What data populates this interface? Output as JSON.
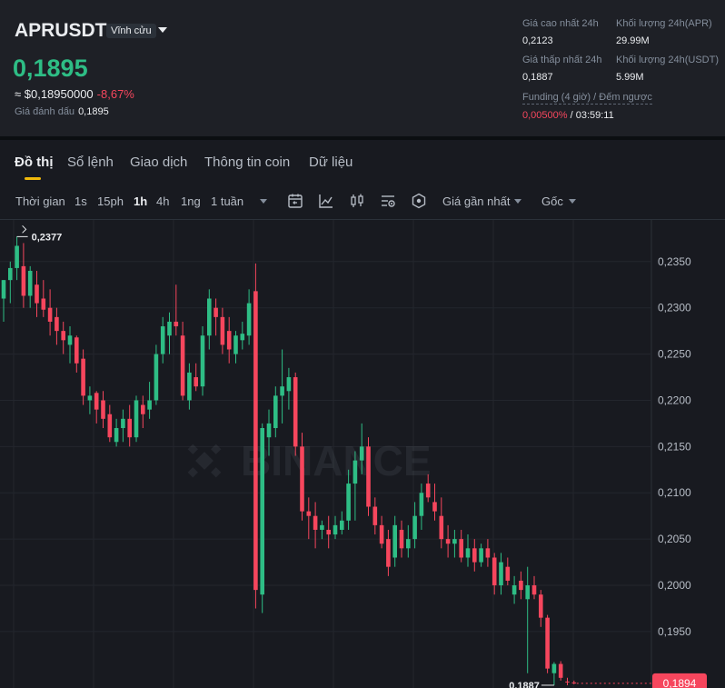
{
  "header": {
    "symbol": "APRUSDT",
    "contract_type": "Vĩnh cửu",
    "last_price": "0,1895",
    "approx_usd": "≈ $0,18950000",
    "change_pct": "-8,67%",
    "mark_label": "Giá đánh dấu",
    "mark_price": "0,1895",
    "stats": {
      "high_label": "Giá cao nhất 24h",
      "high_value": "0,2123",
      "vol_base_label": "Khối lượng 24h(APR)",
      "vol_base_value": "29.99M",
      "low_label": "Giá thấp nhất 24h",
      "low_value": "0,1887",
      "vol_quote_label": "Khối lượng 24h(USDT)",
      "vol_quote_value": "5.99M",
      "funding_label": "Funding (4 giờ) / Đếm ngược",
      "funding_rate": "0,00500%",
      "funding_sep": " / ",
      "countdown": "03:59:11"
    }
  },
  "tabs": [
    "Đồ thị",
    "Sổ lệnh",
    "Giao dịch",
    "Thông tin coin",
    "Dữ liệu"
  ],
  "toolbar": {
    "time_label": "Thời gian",
    "intervals": [
      "1s",
      "15ph",
      "1h",
      "4h",
      "1ng",
      "1 tuần"
    ],
    "active_interval": "1h",
    "price_source": "Giá gần nhất",
    "scale": "Gốc",
    "icons": [
      "calendar-icon",
      "indicator-icon",
      "candle-type-icon",
      "chart-settings-icon",
      "depth-icon"
    ]
  },
  "chart_data": {
    "type": "candlestick",
    "interval": "1h",
    "watermark": "BINANCE",
    "y_ticks": [
      "0,2350",
      "0,2300",
      "0,2250",
      "0,2200",
      "0,2150",
      "0,2100",
      "0,2050",
      "0,2000",
      "0,1950"
    ],
    "ylim": [
      0.1889,
      0.2395
    ],
    "high_marker": "0,2377",
    "low_marker": "0,1887",
    "current_price_label": "0,1894",
    "colors": {
      "up": "#2ebd85",
      "down": "#f6465d",
      "grid": "#23262d",
      "axis_text": "#b7bdc6"
    },
    "candles": [
      {
        "o": 0.231,
        "h": 0.233,
        "l": 0.2285,
        "c": 0.233
      },
      {
        "o": 0.233,
        "h": 0.235,
        "l": 0.2305,
        "c": 0.2343
      },
      {
        "o": 0.2343,
        "h": 0.2377,
        "l": 0.233,
        "c": 0.2367
      },
      {
        "o": 0.2345,
        "h": 0.237,
        "l": 0.23,
        "c": 0.2313
      },
      {
        "o": 0.2313,
        "h": 0.2345,
        "l": 0.23,
        "c": 0.234
      },
      {
        "o": 0.2325,
        "h": 0.234,
        "l": 0.229,
        "c": 0.2305
      },
      {
        "o": 0.231,
        "h": 0.233,
        "l": 0.229,
        "c": 0.2298
      },
      {
        "o": 0.23,
        "h": 0.232,
        "l": 0.227,
        "c": 0.2285
      },
      {
        "o": 0.229,
        "h": 0.23,
        "l": 0.226,
        "c": 0.2275
      },
      {
        "o": 0.2275,
        "h": 0.2285,
        "l": 0.225,
        "c": 0.2265
      },
      {
        "o": 0.226,
        "h": 0.228,
        "l": 0.224,
        "c": 0.227
      },
      {
        "o": 0.2268,
        "h": 0.227,
        "l": 0.223,
        "c": 0.224
      },
      {
        "o": 0.2245,
        "h": 0.2255,
        "l": 0.2195,
        "c": 0.2205
      },
      {
        "o": 0.22,
        "h": 0.2215,
        "l": 0.2185,
        "c": 0.2205
      },
      {
        "o": 0.2208,
        "h": 0.221,
        "l": 0.2175,
        "c": 0.219
      },
      {
        "o": 0.22,
        "h": 0.221,
        "l": 0.217,
        "c": 0.218
      },
      {
        "o": 0.2185,
        "h": 0.2195,
        "l": 0.2155,
        "c": 0.216
      },
      {
        "o": 0.2155,
        "h": 0.218,
        "l": 0.215,
        "c": 0.217
      },
      {
        "o": 0.217,
        "h": 0.219,
        "l": 0.2155,
        "c": 0.218
      },
      {
        "o": 0.218,
        "h": 0.2195,
        "l": 0.215,
        "c": 0.216
      },
      {
        "o": 0.216,
        "h": 0.2205,
        "l": 0.2155,
        "c": 0.22
      },
      {
        "o": 0.2195,
        "h": 0.2205,
        "l": 0.217,
        "c": 0.2185
      },
      {
        "o": 0.219,
        "h": 0.222,
        "l": 0.218,
        "c": 0.22
      },
      {
        "o": 0.22,
        "h": 0.226,
        "l": 0.2195,
        "c": 0.225
      },
      {
        "o": 0.225,
        "h": 0.229,
        "l": 0.224,
        "c": 0.228
      },
      {
        "o": 0.227,
        "h": 0.2295,
        "l": 0.225,
        "c": 0.2285
      },
      {
        "o": 0.2285,
        "h": 0.2325,
        "l": 0.227,
        "c": 0.228
      },
      {
        "o": 0.227,
        "h": 0.2285,
        "l": 0.22,
        "c": 0.2205
      },
      {
        "o": 0.22,
        "h": 0.224,
        "l": 0.219,
        "c": 0.223
      },
      {
        "o": 0.2225,
        "h": 0.224,
        "l": 0.221,
        "c": 0.2215
      },
      {
        "o": 0.2215,
        "h": 0.228,
        "l": 0.2205,
        "c": 0.227
      },
      {
        "o": 0.227,
        "h": 0.232,
        "l": 0.2255,
        "c": 0.231
      },
      {
        "o": 0.23,
        "h": 0.231,
        "l": 0.227,
        "c": 0.229
      },
      {
        "o": 0.229,
        "h": 0.23,
        "l": 0.225,
        "c": 0.226
      },
      {
        "o": 0.2275,
        "h": 0.229,
        "l": 0.224,
        "c": 0.2255
      },
      {
        "o": 0.225,
        "h": 0.2275,
        "l": 0.224,
        "c": 0.227
      },
      {
        "o": 0.2265,
        "h": 0.2285,
        "l": 0.2255,
        "c": 0.2272
      },
      {
        "o": 0.227,
        "h": 0.232,
        "l": 0.226,
        "c": 0.2305
      },
      {
        "o": 0.2318,
        "h": 0.2348,
        "l": 0.1975,
        "c": 0.1995
      },
      {
        "o": 0.199,
        "h": 0.2175,
        "l": 0.197,
        "c": 0.217
      },
      {
        "o": 0.216,
        "h": 0.219,
        "l": 0.214,
        "c": 0.2175
      },
      {
        "o": 0.217,
        "h": 0.2215,
        "l": 0.216,
        "c": 0.2205
      },
      {
        "o": 0.2205,
        "h": 0.2255,
        "l": 0.2175,
        "c": 0.2215
      },
      {
        "o": 0.221,
        "h": 0.2235,
        "l": 0.219,
        "c": 0.2225
      },
      {
        "o": 0.2225,
        "h": 0.223,
        "l": 0.214,
        "c": 0.215
      },
      {
        "o": 0.215,
        "h": 0.2165,
        "l": 0.207,
        "c": 0.208
      },
      {
        "o": 0.208,
        "h": 0.2095,
        "l": 0.205,
        "c": 0.2075
      },
      {
        "o": 0.2075,
        "h": 0.209,
        "l": 0.204,
        "c": 0.206
      },
      {
        "o": 0.206,
        "h": 0.207,
        "l": 0.205,
        "c": 0.2065
      },
      {
        "o": 0.206,
        "h": 0.2075,
        "l": 0.204,
        "c": 0.2055
      },
      {
        "o": 0.2055,
        "h": 0.2075,
        "l": 0.205,
        "c": 0.2065
      },
      {
        "o": 0.206,
        "h": 0.208,
        "l": 0.2055,
        "c": 0.207
      },
      {
        "o": 0.207,
        "h": 0.2125,
        "l": 0.206,
        "c": 0.211
      },
      {
        "o": 0.211,
        "h": 0.2145,
        "l": 0.207,
        "c": 0.2135
      },
      {
        "o": 0.2135,
        "h": 0.2175,
        "l": 0.212,
        "c": 0.215
      },
      {
        "o": 0.215,
        "h": 0.216,
        "l": 0.2075,
        "c": 0.2085
      },
      {
        "o": 0.2085,
        "h": 0.2095,
        "l": 0.2055,
        "c": 0.2065
      },
      {
        "o": 0.2065,
        "h": 0.2075,
        "l": 0.204,
        "c": 0.2045
      },
      {
        "o": 0.205,
        "h": 0.206,
        "l": 0.201,
        "c": 0.202
      },
      {
        "o": 0.203,
        "h": 0.2075,
        "l": 0.202,
        "c": 0.2065
      },
      {
        "o": 0.206,
        "h": 0.207,
        "l": 0.203,
        "c": 0.204
      },
      {
        "o": 0.204,
        "h": 0.2065,
        "l": 0.203,
        "c": 0.205
      },
      {
        "o": 0.205,
        "h": 0.209,
        "l": 0.204,
        "c": 0.2075
      },
      {
        "o": 0.2075,
        "h": 0.211,
        "l": 0.206,
        "c": 0.21
      },
      {
        "o": 0.211,
        "h": 0.212,
        "l": 0.209,
        "c": 0.2095
      },
      {
        "o": 0.209,
        "h": 0.211,
        "l": 0.207,
        "c": 0.208
      },
      {
        "o": 0.2075,
        "h": 0.2095,
        "l": 0.204,
        "c": 0.205
      },
      {
        "o": 0.205,
        "h": 0.2065,
        "l": 0.203,
        "c": 0.2045
      },
      {
        "o": 0.2045,
        "h": 0.206,
        "l": 0.203,
        "c": 0.205
      },
      {
        "o": 0.205,
        "h": 0.206,
        "l": 0.2025,
        "c": 0.203
      },
      {
        "o": 0.203,
        "h": 0.2055,
        "l": 0.202,
        "c": 0.204
      },
      {
        "o": 0.204,
        "h": 0.205,
        "l": 0.2015,
        "c": 0.2025
      },
      {
        "o": 0.2025,
        "h": 0.2045,
        "l": 0.202,
        "c": 0.204
      },
      {
        "o": 0.204,
        "h": 0.205,
        "l": 0.202,
        "c": 0.203
      },
      {
        "o": 0.203,
        "h": 0.2035,
        "l": 0.199,
        "c": 0.2
      },
      {
        "o": 0.2,
        "h": 0.2035,
        "l": 0.199,
        "c": 0.2025
      },
      {
        "o": 0.202,
        "h": 0.203,
        "l": 0.2,
        "c": 0.2005
      },
      {
        "o": 0.199,
        "h": 0.201,
        "l": 0.198,
        "c": 0.2
      },
      {
        "o": 0.2005,
        "h": 0.2015,
        "l": 0.1985,
        "c": 0.1995
      },
      {
        "o": 0.1985,
        "h": 0.202,
        "l": 0.1905,
        "c": 0.2
      },
      {
        "o": 0.2,
        "h": 0.201,
        "l": 0.1985,
        "c": 0.199
      },
      {
        "o": 0.199,
        "h": 0.1995,
        "l": 0.1955,
        "c": 0.1965
      },
      {
        "o": 0.1965,
        "h": 0.1968,
        "l": 0.1905,
        "c": 0.191
      },
      {
        "o": 0.1905,
        "h": 0.1917,
        "l": 0.1892,
        "c": 0.1915
      },
      {
        "o": 0.1915,
        "h": 0.1918,
        "l": 0.1897,
        "c": 0.19
      },
      {
        "o": 0.1896,
        "h": 0.19,
        "l": 0.1892,
        "c": 0.1895
      },
      {
        "o": 0.1895,
        "h": 0.1897,
        "l": 0.1893,
        "c": 0.1894
      }
    ]
  }
}
